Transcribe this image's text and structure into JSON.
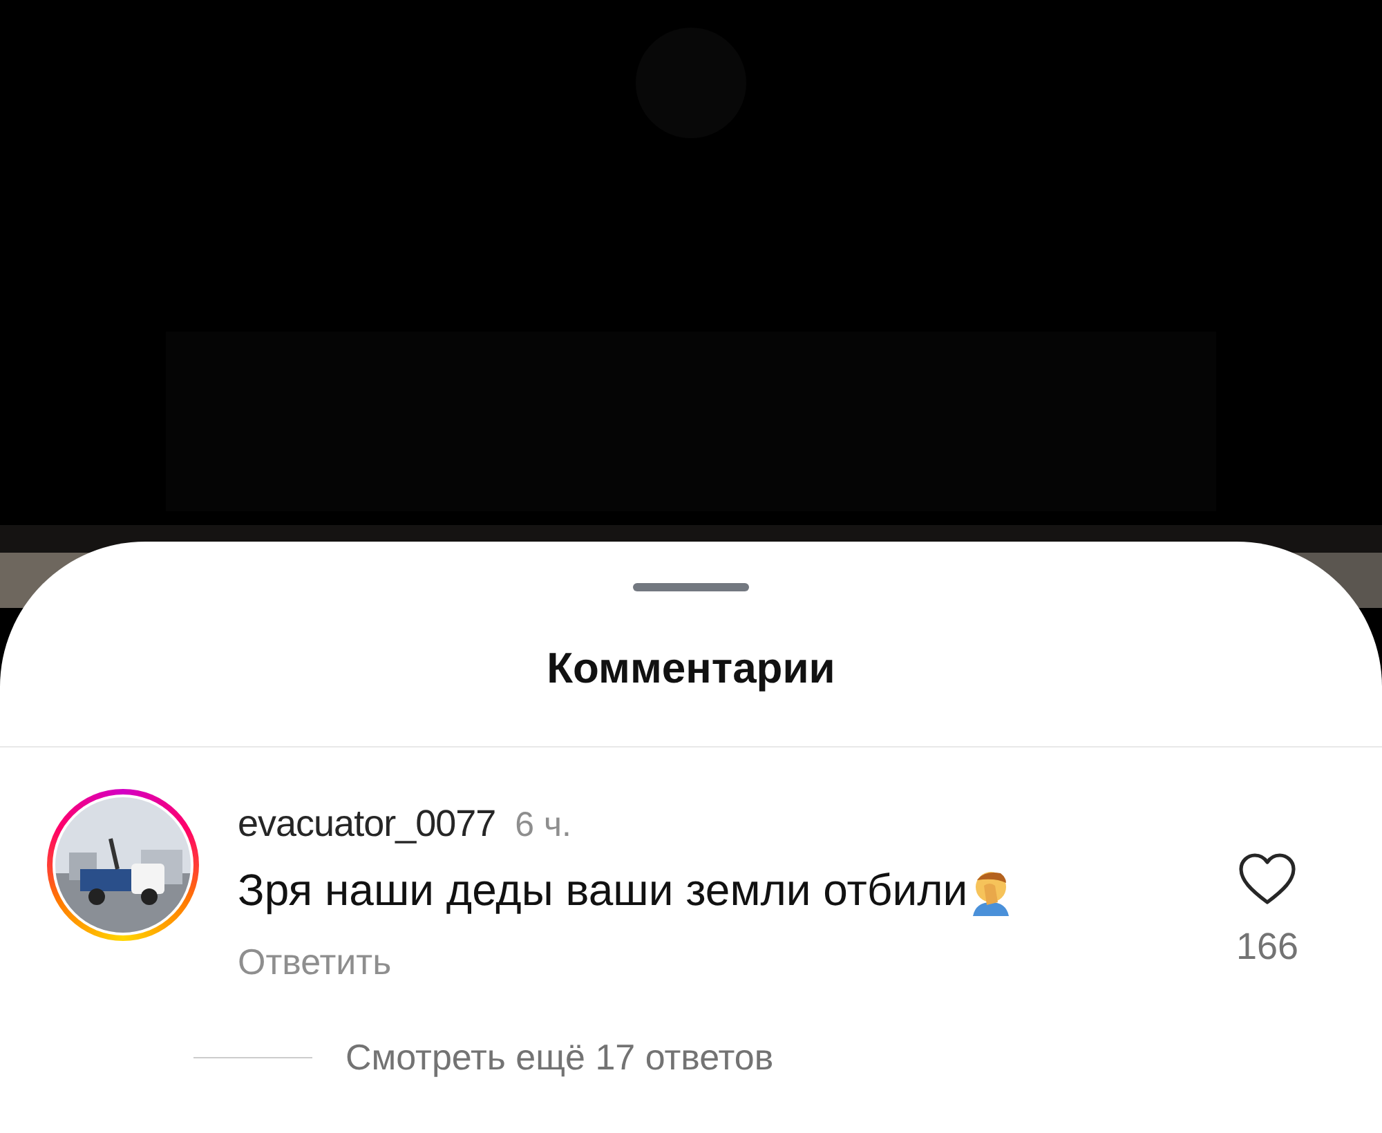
{
  "sheet": {
    "title": "Комментарии"
  },
  "comments": [
    {
      "username": "evacuator_0077",
      "time": "6 ч.",
      "text": "Зря наши деды ваши земли отбили",
      "has_story": true,
      "reply": "Ответить",
      "liked": false,
      "likes": "166",
      "more_replies": "Смотреть ещё 17 ответов"
    }
  ]
}
